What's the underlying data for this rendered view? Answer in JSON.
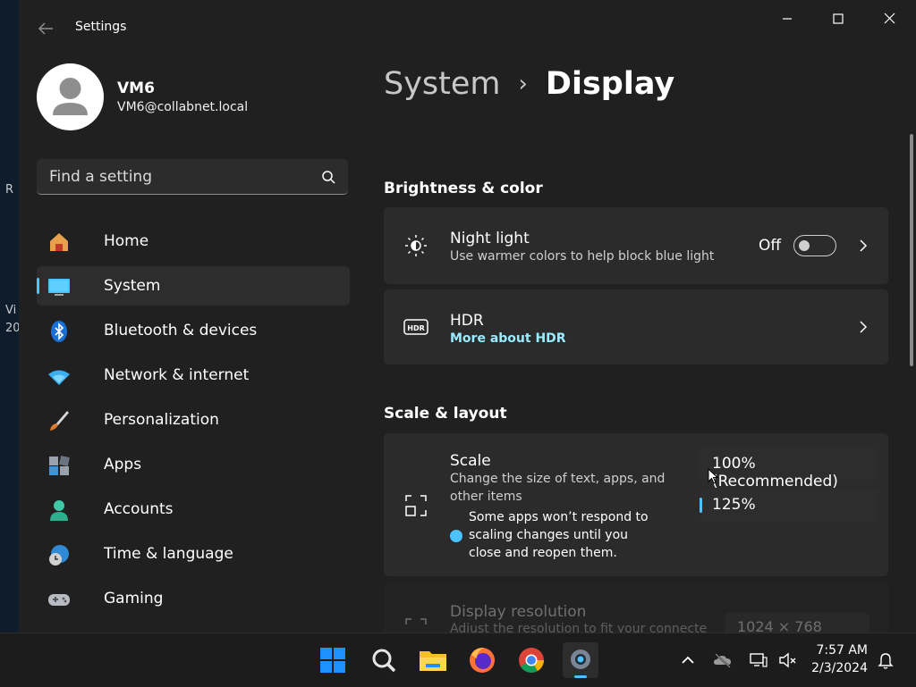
{
  "desktop": {
    "fragments": [
      "R",
      "Vi",
      "20"
    ]
  },
  "window": {
    "title": "Settings"
  },
  "user": {
    "name": "VM6",
    "email": "VM6@collabnet.local"
  },
  "search": {
    "placeholder": "Find a setting"
  },
  "nav": {
    "items": [
      {
        "label": "Home",
        "icon": "home-icon"
      },
      {
        "label": "System",
        "icon": "monitor-icon",
        "active": true
      },
      {
        "label": "Bluetooth & devices",
        "icon": "bluetooth-icon"
      },
      {
        "label": "Network & internet",
        "icon": "wifi-icon"
      },
      {
        "label": "Personalization",
        "icon": "brush-icon"
      },
      {
        "label": "Apps",
        "icon": "apps-icon"
      },
      {
        "label": "Accounts",
        "icon": "person-icon"
      },
      {
        "label": "Time & language",
        "icon": "globe-clock-icon"
      },
      {
        "label": "Gaming",
        "icon": "gamepad-icon"
      }
    ]
  },
  "breadcrumb": {
    "parent": "System",
    "separator": "›",
    "current": "Display"
  },
  "brightness": {
    "heading": "Brightness & color",
    "night_light": {
      "title": "Night light",
      "subtitle": "Use warmer colors to help block blue light",
      "state": "Off"
    },
    "hdr": {
      "title": "HDR",
      "link": "More about HDR"
    }
  },
  "scale_layout": {
    "heading": "Scale & layout",
    "scale": {
      "title": "Scale",
      "subtitle_line1": "Change the size of text, apps, and",
      "subtitle_line2": "other items",
      "info_line1": "Some apps won’t respond to",
      "info_line2": "scaling changes until you",
      "info_line3": "close and reopen them.",
      "options": [
        "100% (Recommended)",
        "125%"
      ],
      "selected": "125%"
    },
    "resolution": {
      "title": "Display resolution",
      "subtitle": "Adjust the resolution to fit your connecte",
      "value": "1024 × 768"
    }
  },
  "taskbar": {
    "apps": [
      "windows-start-icon",
      "search-icon",
      "file-explorer-icon",
      "firefox-icon",
      "chrome-icon",
      "settings-icon"
    ],
    "time": "7:57 AM",
    "date": "2/3/2024"
  },
  "colors": {
    "accent": "#4cc2ff",
    "link": "#99ebff",
    "window_bg": "#202020",
    "card_bg": "#2b2b2b"
  }
}
